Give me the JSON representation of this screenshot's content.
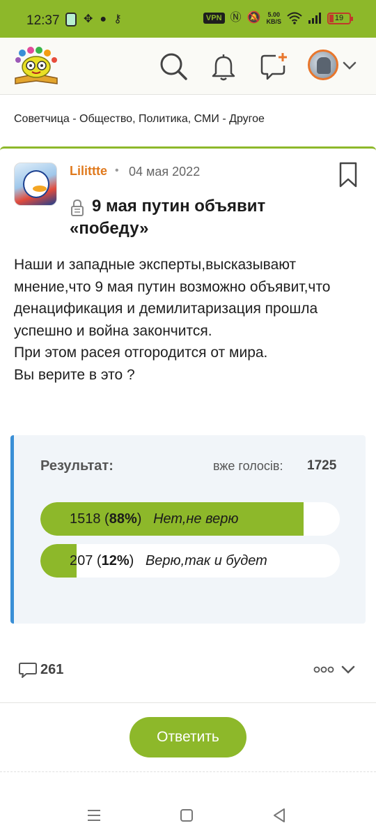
{
  "status_bar": {
    "time": "12:37",
    "vpn": "VPN",
    "speed_value": "5.00",
    "speed_unit": "KB/S",
    "battery": "19"
  },
  "header": {
    "logo": "sovetchica-logo",
    "icons": [
      "search-icon",
      "bell-icon",
      "new-post-icon",
      "avatar",
      "chevron-down-icon"
    ]
  },
  "breadcrumb": {
    "text": "Советчица - Общество, Политика, СМИ - Другое"
  },
  "post": {
    "author": "Lilittte",
    "separator": "•",
    "date": "04 мая 2022",
    "title": "9 мая путин объявит «победу»",
    "body_lines": [
      "Наши и западные эксперты,высказывают мнение,что 9 мая путин возможно объявит,что денацификация и демилитаризация прошла успешно и война закончится.",
      "При этом расея отгородится от мира.",
      "Вы верите в это ?"
    ]
  },
  "poll": {
    "result_label": "Результат:",
    "votes_label": "вже голосів:",
    "votes_total": "1725",
    "options": [
      {
        "count": "1518",
        "percent": "88%",
        "label": "Нет,не верю",
        "share": 0.88
      },
      {
        "count": "207",
        "percent": "12%",
        "label": "Верю,так и будет",
        "share": 0.12
      }
    ]
  },
  "actions": {
    "comments_count": "261",
    "reply_label": "Ответить"
  },
  "colors": {
    "accent": "#8db82a",
    "author": "#e07a1e",
    "poll_border": "#3a8fd6",
    "poll_bg": "#f1f5f9"
  }
}
